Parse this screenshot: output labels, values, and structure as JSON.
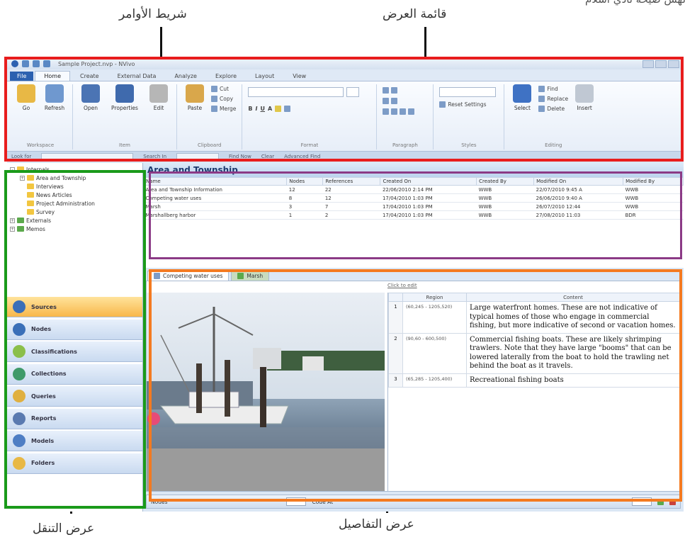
{
  "annotations": {
    "command_bar": "شريط الأوامر",
    "list_view": "قائمة العرض",
    "navigation_view": "عرض التنقل",
    "detail_view": "عرض التفاصيل",
    "top_cut": "لهش صيحة نادي اسلام"
  },
  "colors": {
    "command_bar_frame": "#e81d1d",
    "list_view_frame": "#8b3a86",
    "navigation_frame": "#1a9a1a",
    "detail_frame": "#f47a20"
  },
  "window": {
    "title": "Sample Project.nvp - NVivo"
  },
  "ribbon": {
    "file_tab": "File",
    "tabs": [
      "Home",
      "Create",
      "External Data",
      "Analyze",
      "Explore",
      "Layout",
      "View"
    ],
    "groups": {
      "workspace": {
        "label": "Workspace",
        "buttons": [
          "Go",
          "Refresh"
        ]
      },
      "item": {
        "label": "Item",
        "buttons": [
          "Open",
          "Properties",
          "Edit"
        ]
      },
      "clipboard": {
        "label": "Clipboard",
        "paste": "Paste",
        "small": [
          "Cut",
          "Copy",
          "Merge"
        ]
      },
      "format": {
        "label": "Format",
        "buttons": [
          "B",
          "I",
          "U",
          "A"
        ]
      },
      "paragraph": {
        "label": "Paragraph"
      },
      "styles": {
        "label": "Styles",
        "reset": "Reset Settings"
      },
      "editing": {
        "label": "Editing",
        "select": "Select",
        "small": [
          "Find",
          "Replace",
          "Delete"
        ],
        "insert": "Insert"
      }
    }
  },
  "find_bar": {
    "look_for": "Look for",
    "search_in": "Search In",
    "find_now": "Find Now",
    "clear": "Clear",
    "advanced": "Advanced Find"
  },
  "navigation": {
    "tree": [
      {
        "label": "Internals",
        "level": 0,
        "expander": "-"
      },
      {
        "label": "Area and Township",
        "level": 1,
        "expander": "+"
      },
      {
        "label": "Interviews",
        "level": 1,
        "expander": ""
      },
      {
        "label": "News Articles",
        "level": 1,
        "expander": ""
      },
      {
        "label": "Project Administration",
        "level": 1,
        "expander": ""
      },
      {
        "label": "Survey",
        "level": 1,
        "expander": ""
      },
      {
        "label": "Externals",
        "level": 0,
        "expander": "+"
      },
      {
        "label": "Memos",
        "level": 0,
        "expander": "+"
      }
    ],
    "buttons": [
      "Sources",
      "Nodes",
      "Classifications",
      "Collections",
      "Queries",
      "Reports",
      "Models",
      "Folders"
    ]
  },
  "list_view": {
    "title": "Area and Township",
    "columns": [
      "Name",
      "Nodes",
      "References",
      "Created On",
      "Created By",
      "Modified On",
      "Modified By"
    ],
    "rows": [
      [
        "Area and Township Information",
        "12",
        "22",
        "22/06/2010 2:14 PM",
        "WWB",
        "22/07/2010 9:45 A",
        "WWB"
      ],
      [
        "Competing water uses",
        "8",
        "12",
        "17/04/2010 1:03 PM",
        "WWB",
        "26/06/2010 9:40 A",
        "WWB"
      ],
      [
        "Marsh",
        "3",
        "7",
        "17/04/2010 1:03 PM",
        "WWB",
        "26/07/2010 12:44",
        "WWB"
      ],
      [
        "Marshallberg harbor",
        "1",
        "2",
        "17/04/2010 1:03 PM",
        "WWB",
        "27/08/2010 11:03",
        "BDR"
      ]
    ]
  },
  "detail_view": {
    "tabs": [
      "Competing water uses",
      "Marsh"
    ],
    "click_to_edit": "Click to edit",
    "region_columns": [
      "Region",
      "Content"
    ],
    "regions": [
      {
        "num": "1",
        "region": "(60,245 - 1205,520)",
        "content": "Large waterfront homes. These are not indicative of typical homes of those who engage in commercial fishing, but more indicative of second or vacation homes."
      },
      {
        "num": "2",
        "region": "(90,60 - 600,500)",
        "content": "Commercial fishing boats. These are likely shrimping trawlers. Note that they have large \"booms\" that can be lowered laterally from the boat to hold the trawling net behind the boat as it travels."
      },
      {
        "num": "3",
        "region": "(65,285 - 1205,400)",
        "content": "Recreational fishing boats"
      }
    ],
    "status": {
      "nodes": "Nodes",
      "code_at": "Code At"
    }
  }
}
